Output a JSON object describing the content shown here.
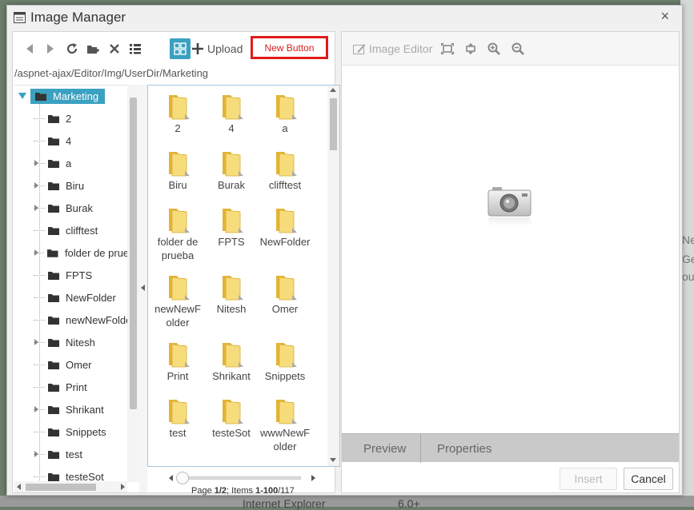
{
  "colors": {
    "accent": "#3aa1c1",
    "highlight_border": "#e01b1b",
    "folder": "#f2c94c"
  },
  "background": {
    "right_texts": [
      "Ne",
      "Ge",
      "ou"
    ],
    "bottom_texts": [
      "Internet Explorer",
      "6.0+"
    ]
  },
  "dialog": {
    "title": "Image Manager",
    "close_label": "×"
  },
  "toolbar": {
    "buttons": [
      {
        "name": "back-icon"
      },
      {
        "name": "forward-icon"
      },
      {
        "name": "refresh-icon"
      },
      {
        "name": "new-folder-icon"
      },
      {
        "name": "delete-icon"
      },
      {
        "name": "list-view-icon"
      },
      {
        "name": "thumbnail-view-icon",
        "active": true
      }
    ],
    "upload_label": "Upload",
    "new_button_label": "New Button"
  },
  "path": "/aspnet-ajax/Editor/Img/UserDir/Marketing",
  "tree": {
    "root": "Marketing",
    "items": [
      {
        "label": "2",
        "expandable": false
      },
      {
        "label": "4",
        "expandable": false
      },
      {
        "label": "a",
        "expandable": true
      },
      {
        "label": "Biru",
        "expandable": true
      },
      {
        "label": "Burak",
        "expandable": true
      },
      {
        "label": "clifftest",
        "expandable": false
      },
      {
        "label": "folder de prueba",
        "expandable": true
      },
      {
        "label": "FPTS",
        "expandable": false
      },
      {
        "label": "NewFolder",
        "expandable": false
      },
      {
        "label": "newNewFolder",
        "expandable": false
      },
      {
        "label": "Nitesh",
        "expandable": true
      },
      {
        "label": "Omer",
        "expandable": false
      },
      {
        "label": "Print",
        "expandable": false
      },
      {
        "label": "Shrikant",
        "expandable": true
      },
      {
        "label": "Snippets",
        "expandable": false
      },
      {
        "label": "test",
        "expandable": true
      },
      {
        "label": "testeSot",
        "expandable": false
      }
    ]
  },
  "files": [
    {
      "rows": [
        "2"
      ]
    },
    {
      "rows": [
        "4"
      ]
    },
    {
      "rows": [
        "a"
      ]
    },
    {
      "rows": [
        "Biru"
      ]
    },
    {
      "rows": [
        "Burak"
      ]
    },
    {
      "rows": [
        "clifftest"
      ]
    },
    {
      "rows": [
        "folder de",
        "prueba"
      ]
    },
    {
      "rows": [
        "FPTS"
      ]
    },
    {
      "rows": [
        "NewFolder"
      ]
    },
    {
      "rows": [
        "newNewF",
        "older"
      ]
    },
    {
      "rows": [
        "Nitesh"
      ]
    },
    {
      "rows": [
        "Omer"
      ]
    },
    {
      "rows": [
        "Print"
      ]
    },
    {
      "rows": [
        "Shrikant"
      ]
    },
    {
      "rows": [
        "Snippets"
      ]
    },
    {
      "rows": [
        "test"
      ]
    },
    {
      "rows": [
        "testeSot"
      ]
    },
    {
      "rows": [
        "wwwNewF",
        "older"
      ]
    }
  ],
  "pager": {
    "page_prefix": "Page ",
    "page": "1/2",
    "items_prefix": "; Items ",
    "items": "1-100",
    "total": "/117"
  },
  "preview_toolbar": {
    "image_editor_label": "Image Editor",
    "buttons": [
      {
        "name": "best-fit-icon"
      },
      {
        "name": "actual-size-icon"
      },
      {
        "name": "zoom-in-icon"
      },
      {
        "name": "zoom-out-icon"
      }
    ]
  },
  "tabs": [
    {
      "label": "Preview"
    },
    {
      "label": "Properties"
    }
  ],
  "actions": {
    "insert_label": "Insert",
    "cancel_label": "Cancel"
  }
}
